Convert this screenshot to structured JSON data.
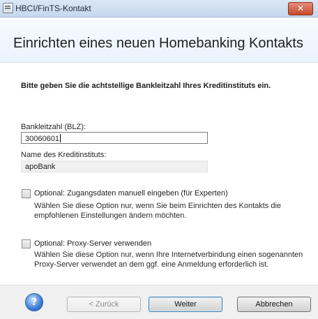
{
  "window": {
    "title": "HBCI/FinTS-Kontakt",
    "close_glyph": "✕"
  },
  "header": {
    "title": "Einrichten eines neuen Homebanking Kontakts"
  },
  "form": {
    "instruction": "Bitte geben Sie die achtstellige Bankleitzahl Ihres Kreditinstituts ein.",
    "blz_label": "Bankleitzahl (BLZ):",
    "blz_value": "30060601",
    "bank_name_label": "Name des Kreditinstituts:",
    "bank_name_value": "apoBank"
  },
  "options": [
    {
      "label": "Optional: Zugangsdaten manuell eingeben (für Experten)",
      "description": "Wählen Sie diese Option nur, wenn Sie beim Einrichten des Kontakts die empfohlenen Einstellungen ändern möchten.",
      "checked": false
    },
    {
      "label": "Optional: Proxy-Server verwenden",
      "description": "Wählen Sie diese Option nur, wenn Ihre Internetverbindung einen sogenannten Proxy-Server verwendet an dem ggf. eine Anmeldung erforderlich ist.",
      "checked": false
    }
  ],
  "footer": {
    "help_icon": "help-icon",
    "back_label": "< Zurück",
    "next_label": "Weiter",
    "cancel_label": "Abbrechen"
  }
}
